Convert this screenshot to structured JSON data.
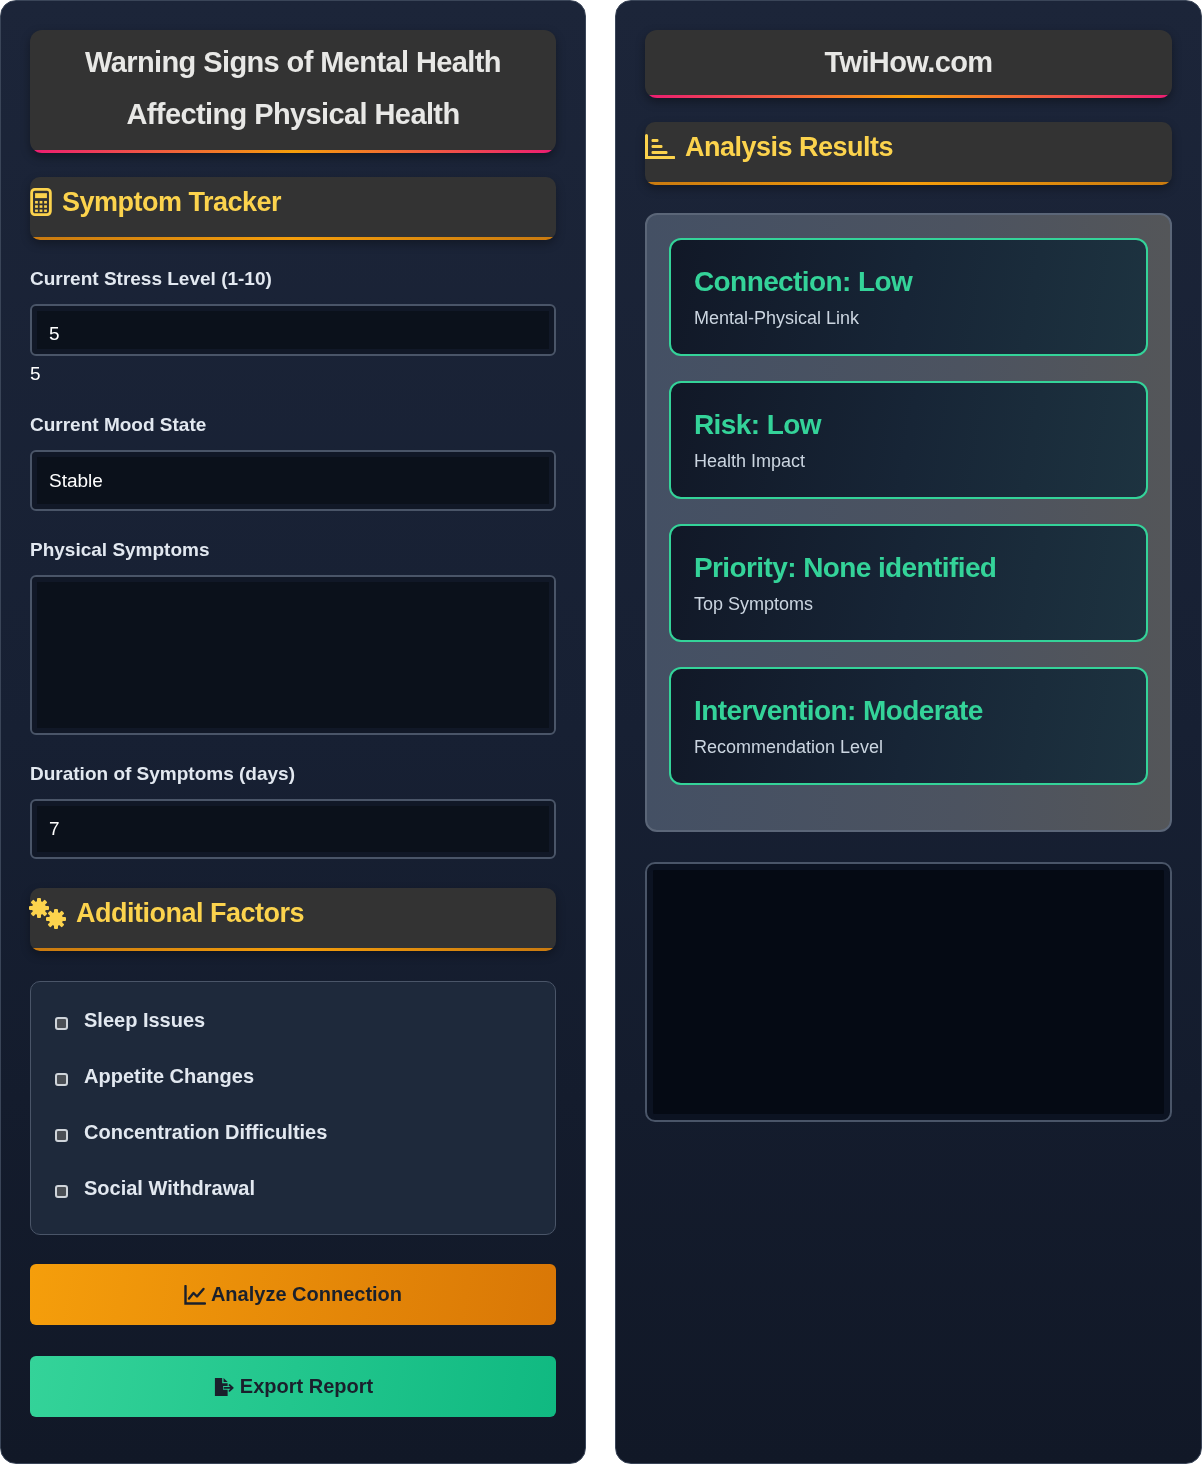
{
  "header": {
    "title": "Warning Signs of Mental Health Affecting Physical Health"
  },
  "symptom_tracker": {
    "heading": "Symptom Tracker",
    "fields": [
      {
        "kind": "range",
        "label": "Current Stress Level (1-10)",
        "value": "5",
        "reading": "5"
      },
      {
        "kind": "select",
        "label": "Current Mood State",
        "value": "Stable"
      },
      {
        "kind": "textarea",
        "label": "Physical Symptoms"
      },
      {
        "kind": "number",
        "label": "Duration of Symptoms (days)",
        "value": "7"
      }
    ]
  },
  "additional_factors": {
    "heading": "Additional Factors",
    "options": [
      {
        "label": "Sleep Issues",
        "checked": false
      },
      {
        "label": "Appetite Changes",
        "checked": false
      },
      {
        "label": "Concentration Difficulties",
        "checked": false
      },
      {
        "label": "Social Withdrawal",
        "checked": false
      }
    ]
  },
  "buttons": [
    {
      "kind": "analyze",
      "label": "Analyze Connection"
    },
    {
      "kind": "export",
      "label": "Export Report"
    }
  ],
  "brand": {
    "title": "TwiHow.com"
  },
  "analysis_results": {
    "heading": "Analysis Results",
    "cards": [
      {
        "title": "Connection: Low",
        "caption": "Mental-Physical Link"
      },
      {
        "title": "Risk: Low",
        "caption": "Health Impact"
      },
      {
        "title": "Priority: None identified",
        "caption": "Top Symptoms"
      },
      {
        "title": "Intervention: Moderate",
        "caption": "Recommendation Level"
      }
    ]
  }
}
